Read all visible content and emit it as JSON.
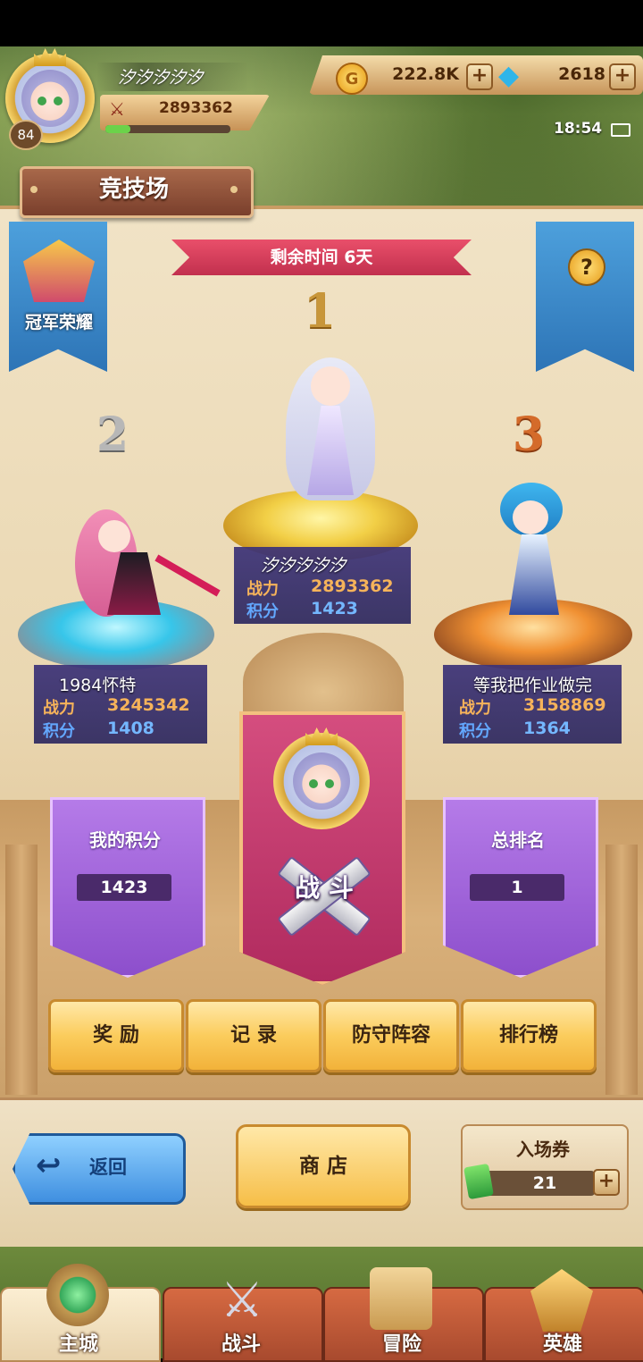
{
  "player": {
    "name": "汐汐汐汐汐",
    "level": "84",
    "power": "2893362",
    "xp_fraction": 0.2
  },
  "currency": {
    "gold": "222.8K",
    "gems": "2618",
    "plus": "+"
  },
  "status": {
    "time": "18:54"
  },
  "page": {
    "title": "竞技场"
  },
  "banners": {
    "champion_label": "冠军荣耀",
    "help_icon": "?"
  },
  "season": {
    "remaining_time": "剩余时间 6天"
  },
  "podium": [
    {
      "rank": "1",
      "name": "汐汐汐汐汐",
      "power_label": "战力",
      "power": "2893362",
      "score_label": "积分",
      "score": "1423"
    },
    {
      "rank": "2",
      "name": "1984怀特",
      "power_label": "战力",
      "power": "3245342",
      "score_label": "积分",
      "score": "1408"
    },
    {
      "rank": "3",
      "name": "等我把作业做完",
      "power_label": "战力",
      "power": "3158869",
      "score_label": "积分",
      "score": "1364"
    }
  ],
  "my_score": {
    "title": "我的积分",
    "value": "1423"
  },
  "total_rank": {
    "title": "总排名",
    "value": "1"
  },
  "fight": {
    "label": "战 斗"
  },
  "actions": {
    "reward": "奖 励",
    "record": "记 录",
    "defense": "防守阵容",
    "leaderboard": "排行榜"
  },
  "bottom": {
    "back": "返回",
    "shop": "商 店",
    "ticket_label": "入场券",
    "ticket_count": "21"
  },
  "nav": {
    "home": "主城",
    "battle": "战斗",
    "adventure": "冒险",
    "heroes": "英雄"
  },
  "colors": {
    "accent_pink": "#d54e7f",
    "banner_purple": "#9d5fd8",
    "banner_blue": "#3d8bd0",
    "button_gold": "#f6be47"
  }
}
